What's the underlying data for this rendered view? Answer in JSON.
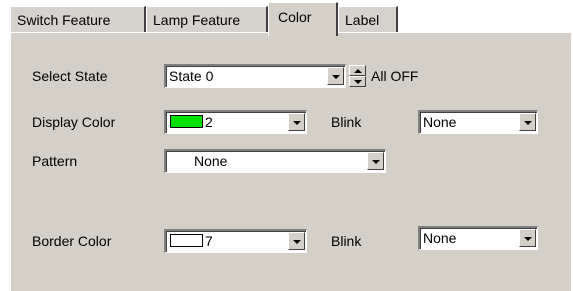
{
  "tabs": [
    {
      "label": "Switch Feature",
      "active": false
    },
    {
      "label": "Lamp Feature",
      "active": false
    },
    {
      "label": "Color",
      "active": true
    },
    {
      "label": "Label",
      "active": false
    }
  ],
  "select_state": {
    "label": "Select State",
    "value": "State 0",
    "state_text": "All OFF"
  },
  "display_color": {
    "label": "Display Color",
    "value": "2",
    "swatch_color": "#00e000"
  },
  "display_blink": {
    "label": "Blink",
    "value": "None"
  },
  "pattern": {
    "label": "Pattern",
    "value": "None"
  },
  "border_color": {
    "label": "Border Color",
    "value": "7",
    "swatch_color": "#ffffff"
  },
  "border_blink": {
    "label": "Blink",
    "value": "None"
  },
  "colors": {
    "panel": "#d4d0c8",
    "window": "#ffffff"
  }
}
